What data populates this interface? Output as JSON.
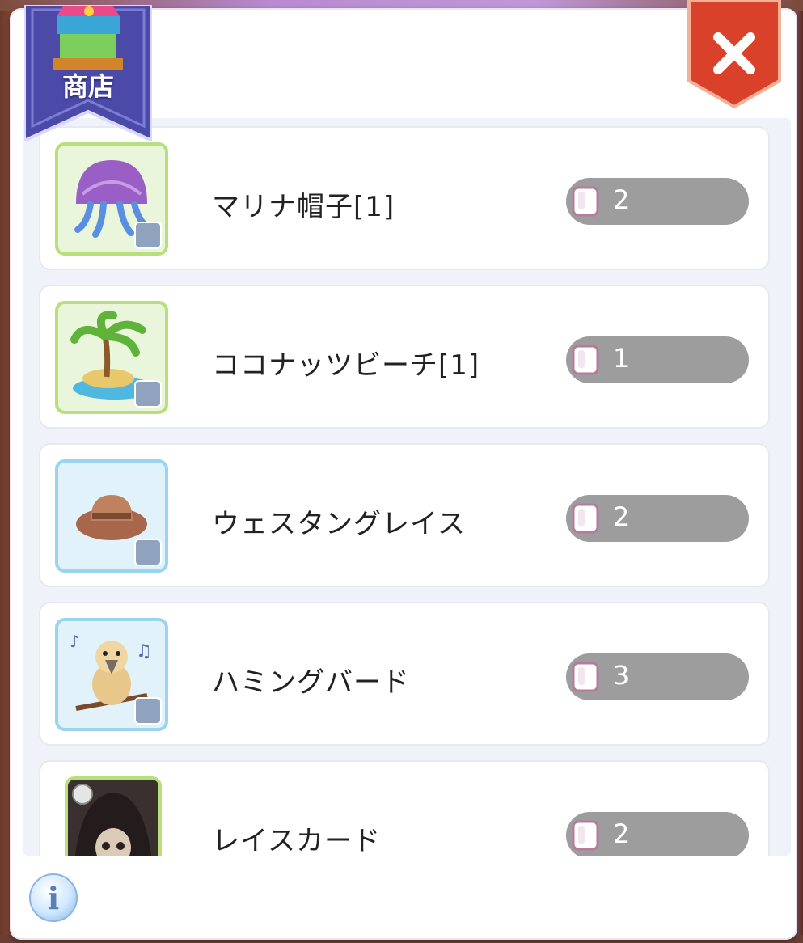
{
  "header": {
    "shop_label": "商店",
    "close_icon": "close-icon",
    "accent_red": "#d9412a",
    "banner_color": "#4b4aa8"
  },
  "items": [
    {
      "name": "マリナ帽子[1]",
      "price": "2",
      "frame": "green",
      "icon": "jellyfish-hat-icon"
    },
    {
      "name": "ココナッツビーチ[1]",
      "price": "1",
      "frame": "green",
      "icon": "palm-island-icon"
    },
    {
      "name": "ウェスタングレイス",
      "price": "2",
      "frame": "blue",
      "icon": "cowboy-hat-icon"
    },
    {
      "name": "ハミングバード",
      "price": "3",
      "frame": "blue",
      "icon": "bird-icon"
    },
    {
      "name": "レイスカード",
      "price": "2",
      "frame": "green",
      "icon": "wraith-card-icon"
    }
  ],
  "currency_icon": "gem-icon",
  "footer": {
    "info_icon": "info-icon",
    "info_glyph": "i"
  }
}
